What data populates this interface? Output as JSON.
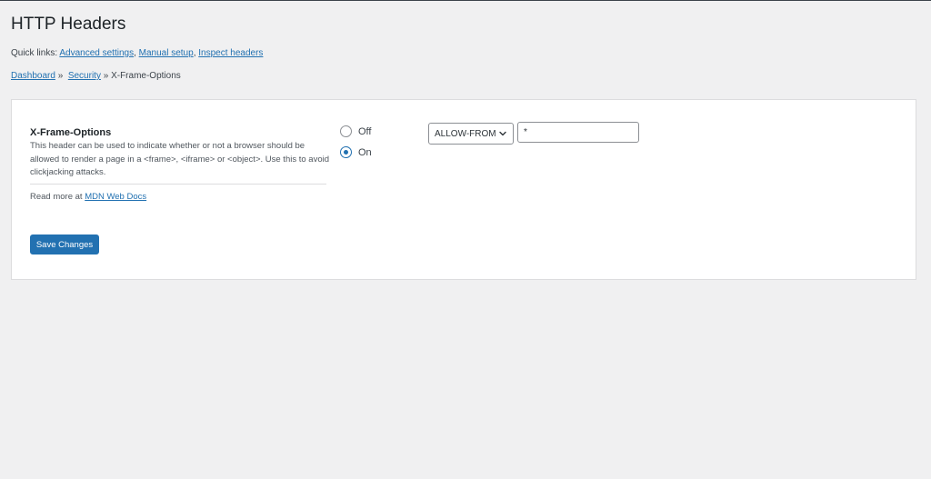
{
  "page": {
    "title": "HTTP Headers"
  },
  "quick_links": {
    "prefix": "Quick links:",
    "links": [
      "Advanced settings",
      "Manual setup",
      "Inspect headers"
    ]
  },
  "breadcrumb": {
    "items": [
      "Dashboard",
      "Security"
    ],
    "separator": "»",
    "current": "X-Frame-Options"
  },
  "setting": {
    "title": "X-Frame-Options",
    "description": "This header can be used to indicate whether or not a browser should be allowed to render a page in a <frame>, <iframe> or <object>. Use this to avoid clickjacking attacks.",
    "read_more_prefix": "Read more at",
    "read_more_link": "MDN Web Docs"
  },
  "options": {
    "radios": [
      {
        "label": "Off",
        "checked": false
      },
      {
        "label": "On",
        "checked": true
      }
    ],
    "select_value": "ALLOW-FROM",
    "input_value": "*"
  },
  "actions": {
    "save_label": "Save Changes"
  },
  "colors": {
    "accent": "#2271b1",
    "background": "#f0f0f1"
  },
  "icons": {
    "select": "chevron-down-icon"
  }
}
